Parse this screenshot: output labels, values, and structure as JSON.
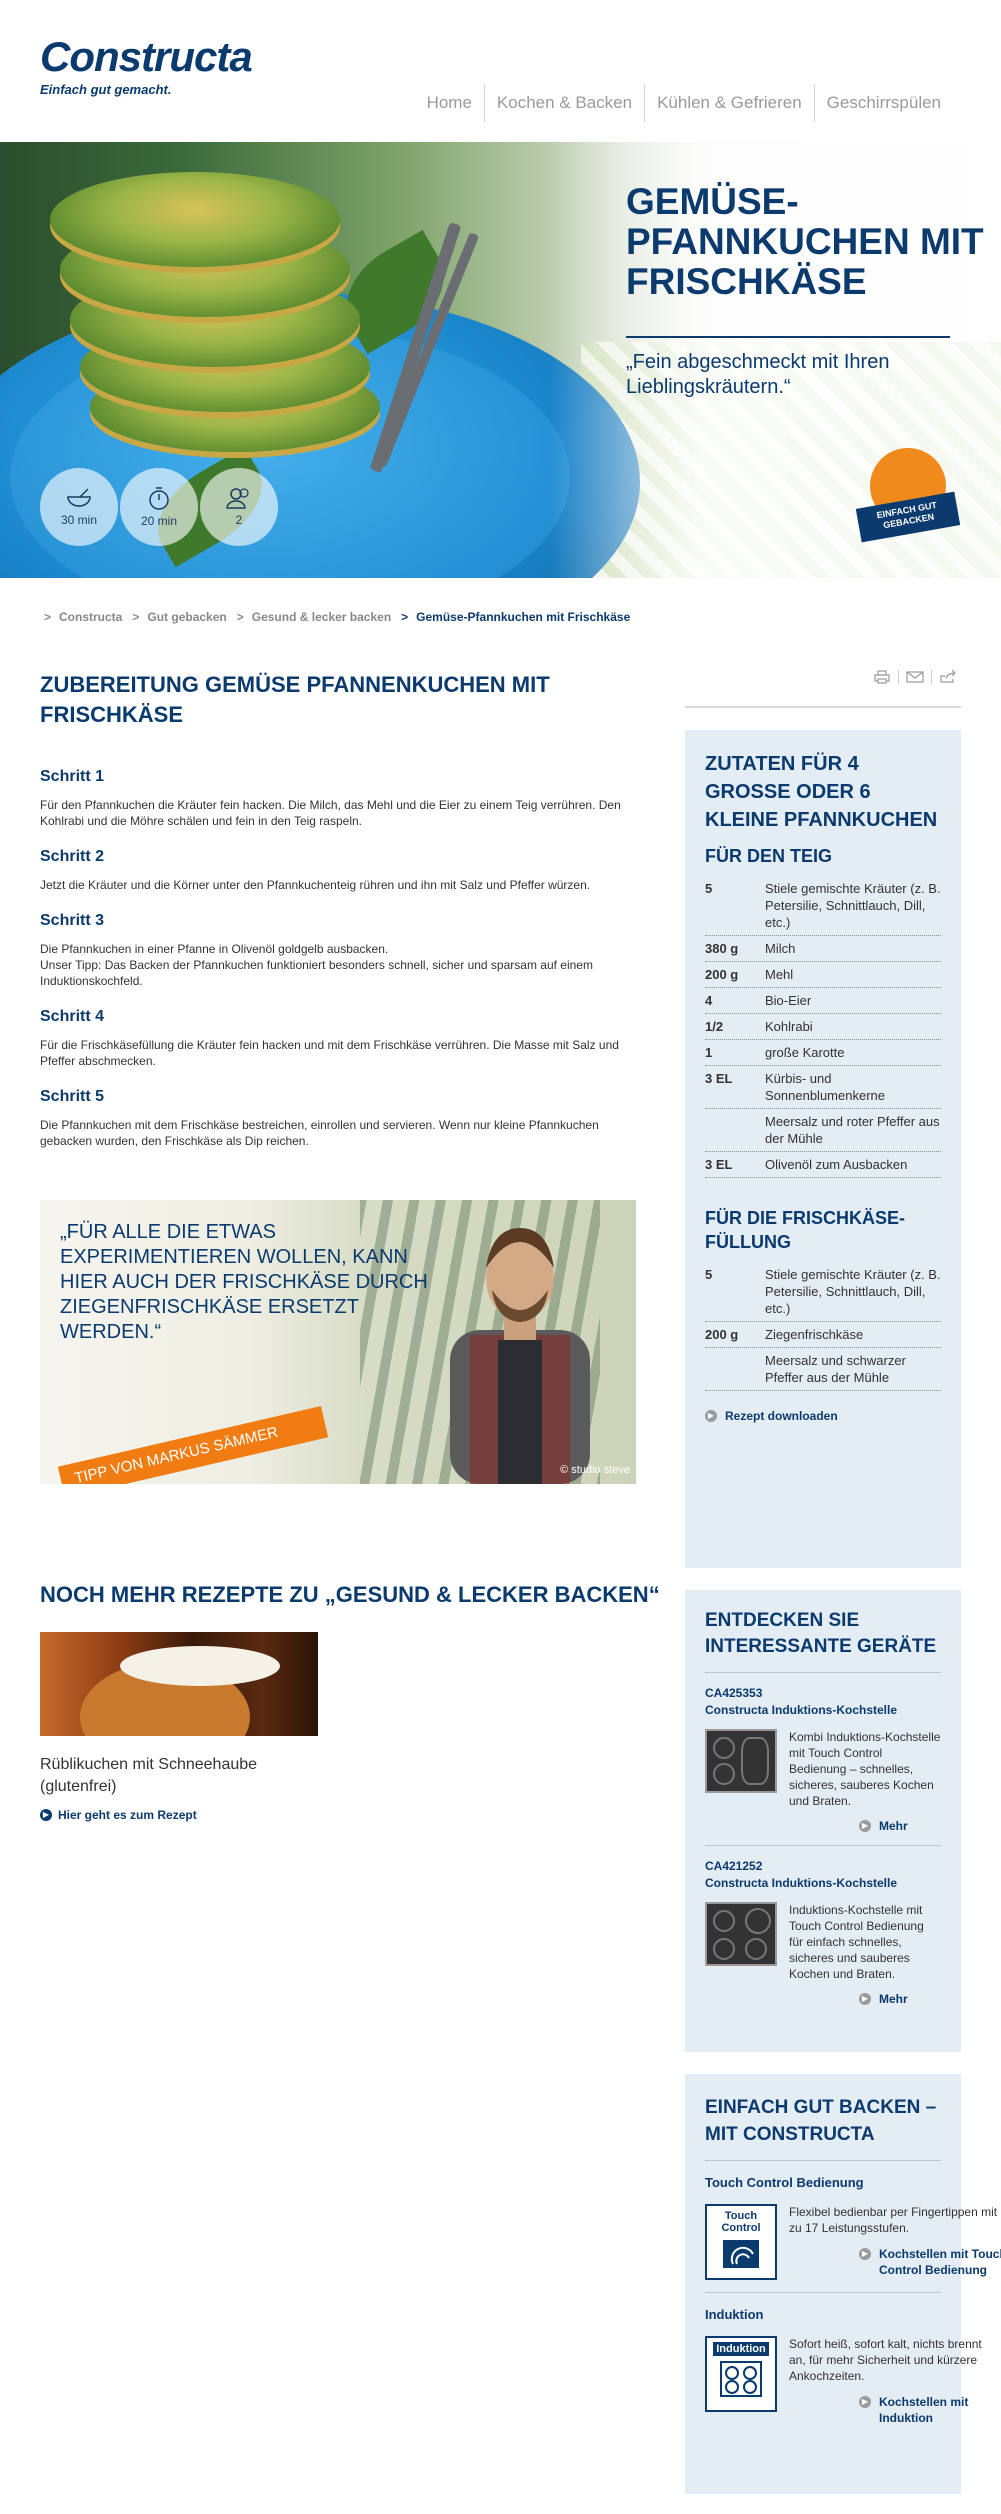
{
  "header": {
    "logo": "Constructa",
    "tagline": "Einfach gut gemacht.",
    "nav": [
      "Home",
      "Kochen & Backen",
      "Kühlen & Gefrieren",
      "Geschirrspülen"
    ]
  },
  "hero": {
    "title": "GEMÜSE-PFANNKUCHEN MIT FRISCHKÄSE",
    "subtitle": "„Fein abgeschmeckt mit Ihren Lieblingskräutern.“",
    "stats": [
      {
        "icon": "bowl-icon",
        "label": "30 min"
      },
      {
        "icon": "stopwatch-icon",
        "label": "20 min"
      },
      {
        "icon": "persons-icon",
        "label": "2"
      }
    ],
    "badge": "EINFACH GUT GEBACKEN"
  },
  "breadcrumb": [
    "Constructa",
    "Gut gebacken",
    "Gesund & lecker backen",
    "Gemüse-Pfannkuchen mit Frischkäse"
  ],
  "main": {
    "title": "ZUBEREITUNG GEMÜSE PFANNENKUCHEN MIT FRISCHKÄSE",
    "steps": [
      {
        "title": "Schritt 1",
        "text": "Für den Pfannkuchen die Kräuter fein hacken. Die Milch, das Mehl und die Eier zu einem Teig verrühren. Den Kohlrabi und die Möhre schälen und fein in den Teig raspeln."
      },
      {
        "title": "Schritt 2",
        "text": "Jetzt die Kräuter und die Körner unter den Pfannkuchenteig rühren und ihn mit Salz und Pfeffer würzen."
      },
      {
        "title": "Schritt 3",
        "text": "Die Pfannkuchen in einer Pfanne in Olivenöl goldgelb ausbacken.\nUnser Tipp: Das Backen der Pfannkuchen funktioniert besonders schnell, sicher und sparsam auf einem Induktionskochfeld."
      },
      {
        "title": "Schritt 4",
        "text": "Für die Frischkäsefüllung die Kräuter fein hacken und mit dem Frischkäse verrühren. Die Masse mit Salz und Pfeffer abschmecken."
      },
      {
        "title": "Schritt 5",
        "text": "Die Pfannkuchen mit dem Frischkäse bestreichen, einrollen und servieren. Wenn nur kleine Pfannkuchen gebacken wurden, den Frischkäse als Dip reichen."
      }
    ]
  },
  "tip": {
    "quote": "„FÜR ALLE DIE ETWAS EXPERIMENTIEREN WOLLEN, KANN HIER AUCH DER FRISCHKÄSE DURCH ZIEGENFRISCHKÄSE ERSETZT WERDEN.“",
    "ribbon": "TIPP VON MARKUS SÄMMER",
    "credit": "© studio steve"
  },
  "more": {
    "title": "NOCH MEHR REZEPTE ZU „GESUND & LECKER BACKEN“",
    "recipe_name": "Rüblikuchen mit Schneehaube (glutenfrei)",
    "link": "Hier geht es zum Rezept"
  },
  "ingredients": {
    "title": "ZUTATEN FÜR 4 GROSSE ODER 6 KLEINE PFANNKUCHEN",
    "dough_title": "FÜR DEN TEIG",
    "dough": [
      {
        "qty": "5",
        "desc": "Stiele gemischte Kräuter (z. B. Petersilie, Schnittlauch, Dill, etc.)"
      },
      {
        "qty": "380 g",
        "desc": "Milch"
      },
      {
        "qty": "200 g",
        "desc": "Mehl"
      },
      {
        "qty": "4",
        "desc": "Bio-Eier"
      },
      {
        "qty": "1/2",
        "desc": "Kohlrabi"
      },
      {
        "qty": "1",
        "desc": "große Karotte"
      },
      {
        "qty": "3 EL",
        "desc": "Kürbis- und Sonnenblumenkerne"
      },
      {
        "qty": "",
        "desc": "Meersalz und roter Pfeffer aus der Mühle"
      },
      {
        "qty": "3 EL",
        "desc": "Olivenöl zum Ausbacken"
      }
    ],
    "filling_title": "FÜR DIE FRISCHKÄSE-FÜLLUNG",
    "filling": [
      {
        "qty": "5",
        "desc": "Stiele gemischte Kräuter (z. B. Petersilie, Schnittlauch, Dill, etc.)"
      },
      {
        "qty": "200 g",
        "desc": "Ziegenfrischkäse"
      },
      {
        "qty": "",
        "desc": "Meersalz und schwarzer Pfeffer aus der Mühle"
      }
    ],
    "download": "Rezept downloaden"
  },
  "devices": {
    "title": "ENTDECKEN SIE INTERESSANTE GERÄTE",
    "items": [
      {
        "code": "CA425353",
        "name": "Constructa Induktions-Kochstelle",
        "text": "Kombi Induktions-Kochstelle mit Touch Control Bedienung – schnelles, sicheres, sauberes Kochen und Braten.",
        "link": "Mehr"
      },
      {
        "code": "CA421252",
        "name": "Constructa Induktions-Kochstelle",
        "text": "Induktions-Kochstelle mit Touch Control Bedienung für einfach schnelles, sicheres und sauberes Kochen und Braten.",
        "link": "Mehr"
      }
    ]
  },
  "features": {
    "title": "EINFACH GUT BACKEN – MIT CONSTRUCTA",
    "items": [
      {
        "title": "Touch Control Bedienung",
        "icon_label": "Touch Control",
        "text": "Flexibel bedienbar per Fingertippen mit bis zu 17 Leistungsstufen.",
        "link": "Kochstellen mit Touch Control Bedienung"
      },
      {
        "title": "Induktion",
        "icon_label": "Induktion",
        "text": "Sofort heiß, sofort kalt, nichts brennt an, für mehr Sicherheit und kürzere Ankochzeiten.",
        "link": "Kochstellen mit Induktion"
      }
    ]
  },
  "colors": {
    "brand": "#0b3a6e",
    "panel": "#e4ecf4",
    "accent": "#f07c12"
  }
}
